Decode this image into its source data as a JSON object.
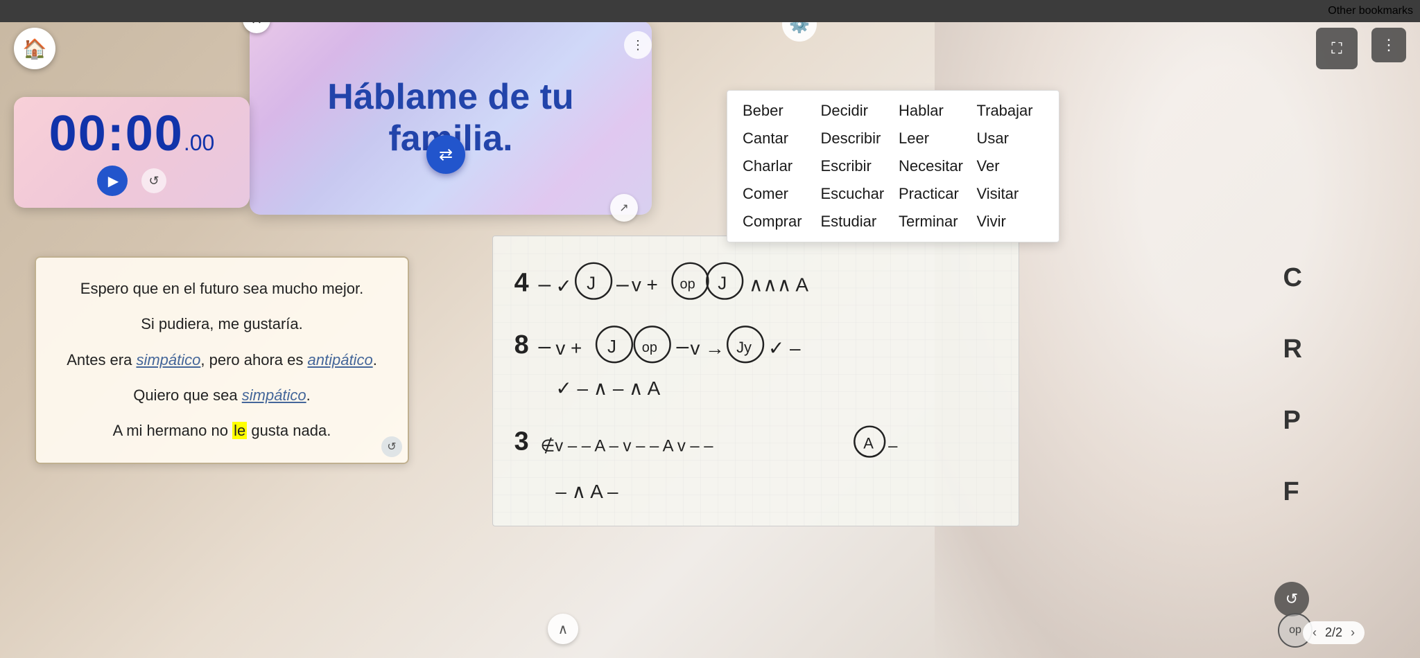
{
  "browser": {
    "bookmarks_label": "Other bookmarks"
  },
  "home": {
    "icon": "🏠"
  },
  "prompt_card": {
    "text": "Háblame de tu familia."
  },
  "timer": {
    "display": "00:00",
    "milliseconds": ".00"
  },
  "verbs": {
    "items": [
      "Beber",
      "Decidir",
      "Hablar",
      "Trabajar",
      "Cantar",
      "Describir",
      "Leer",
      "Usar",
      "Charlar",
      "Escribir",
      "Necesitar",
      "Ver",
      "Comer",
      "Escuchar",
      "Practicar",
      "Visitar",
      "Comprar",
      "Estudiar",
      "Terminar",
      "Vivir"
    ]
  },
  "text_card": {
    "lines": [
      "Espero que en el futuro sea mucho mejor.",
      "Si pudiera, me gustaría.",
      "Antes era simpático, pero ahora es antipático.",
      "Quiero que sea simpático.",
      "A mi hermano no le gusta nada."
    ],
    "italic_words": [
      "simpático",
      "antipático",
      "simpático"
    ],
    "highlight_word": "le"
  },
  "page": {
    "current": "2",
    "total": "2",
    "label": "2/2"
  },
  "column_labels": [
    "C",
    "R",
    "P",
    "F"
  ],
  "whiteboard_numbers": [
    "4",
    "8",
    "3"
  ]
}
